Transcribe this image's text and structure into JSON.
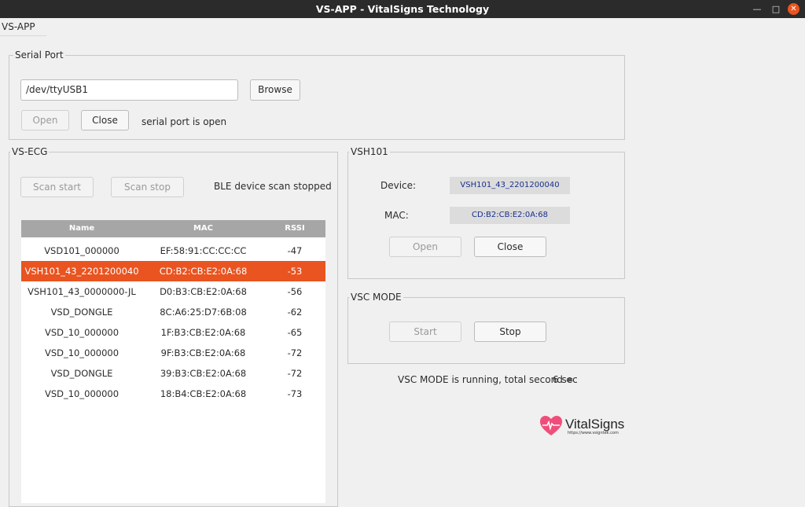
{
  "window": {
    "title": "VS-APP - VitalSigns Technology",
    "min_icon": "minimize-icon",
    "max_icon": "maximize-icon",
    "close_icon": "close-icon"
  },
  "tab": {
    "label": "VS-APP"
  },
  "serial_port": {
    "title": "Serial Port",
    "path_value": "/dev/ttyUSB1",
    "browse_label": "Browse",
    "open_label": "Open",
    "close_label": "Close",
    "status": "serial port is open"
  },
  "vs_ecg": {
    "title": "VS-ECG",
    "scan_start_label": "Scan start",
    "scan_stop_label": "Scan stop",
    "status": "BLE device scan stopped",
    "columns": [
      "Name",
      "MAC",
      "RSSI"
    ],
    "rows": [
      {
        "name": "VSD101_000000",
        "mac": "EF:58:91:CC:CC:CC",
        "rssi": "-47",
        "selected": false
      },
      {
        "name": "VSH101_43_2201200040",
        "mac": "CD:B2:CB:E2:0A:68",
        "rssi": "-53",
        "selected": true
      },
      {
        "name": "VSH101_43_0000000-JL",
        "mac": "D0:B3:CB:E2:0A:68",
        "rssi": "-56",
        "selected": false
      },
      {
        "name": "VSD_DONGLE",
        "mac": "8C:A6:25:D7:6B:08",
        "rssi": "-62",
        "selected": false
      },
      {
        "name": "VSD_10_000000",
        "mac": "1F:B3:CB:E2:0A:68",
        "rssi": "-65",
        "selected": false
      },
      {
        "name": "VSD_10_000000",
        "mac": "9F:B3:CB:E2:0A:68",
        "rssi": "-72",
        "selected": false
      },
      {
        "name": "VSD_DONGLE",
        "mac": "39:B3:CB:E2:0A:68",
        "rssi": "-72",
        "selected": false
      },
      {
        "name": "VSD_10_000000",
        "mac": "18:B4:CB:E2:0A:68",
        "rssi": "-73",
        "selected": false
      }
    ]
  },
  "vsh101": {
    "title": "VSH101",
    "device_label": "Device:",
    "device_value": "VSH101_43_2201200040",
    "mac_label": "MAC:",
    "mac_value": "CD:B2:CB:E2:0A:68",
    "open_label": "Open",
    "close_label": "Close"
  },
  "vsc_mode": {
    "title": "VSC MODE",
    "start_label": "Start",
    "stop_label": "Stop",
    "status_text": "VSC MODE is running, total second =",
    "seconds": "6 sec"
  },
  "logo": {
    "text": "VitalSigns",
    "url": "https://www.vsigntek.com",
    "icon": "heart-pulse-icon"
  },
  "colors": {
    "accent": "#e95420",
    "titlebar": "#2b2b2b",
    "value_text": "#1a2f8a"
  }
}
